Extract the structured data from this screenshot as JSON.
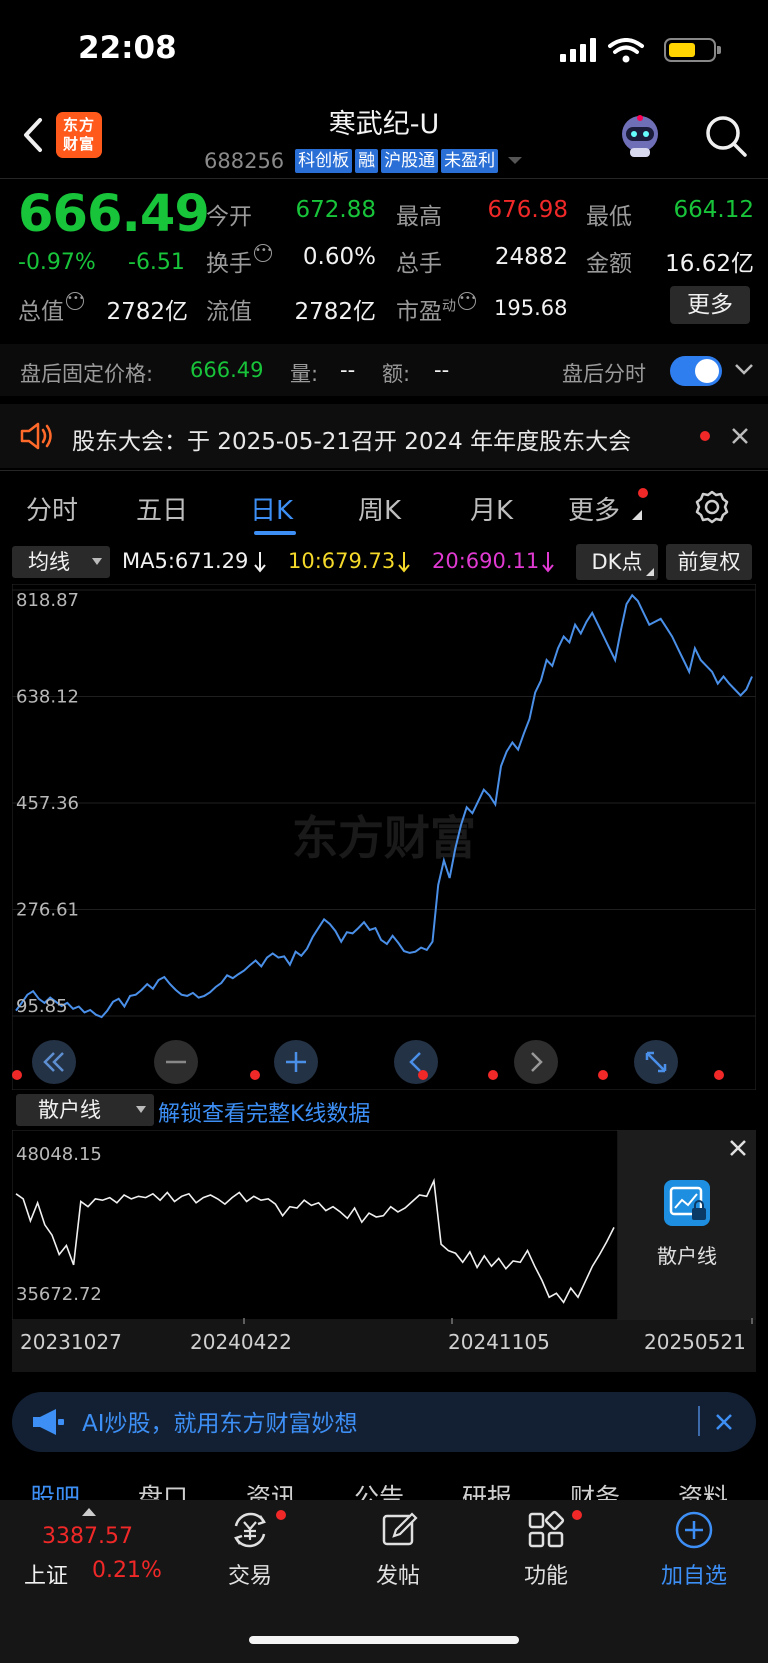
{
  "status_bar": {
    "time": "22:08"
  },
  "header": {
    "logo": "东方财富",
    "name": "寒武纪-U",
    "code": "688256",
    "tags": [
      "科创板",
      "融",
      "沪股通",
      "未盈利"
    ]
  },
  "quote": {
    "price": "666.49",
    "change_pct": "-0.97%",
    "change": "-6.51",
    "open_label": "今开",
    "open": "672.88",
    "high_label": "最高",
    "high": "676.98",
    "low_label": "最低",
    "low": "664.12",
    "turnover_label": "换手",
    "turnover": "0.60%",
    "volume_label": "总手",
    "volume": "24882",
    "amount_label": "金额",
    "amount": "16.62亿",
    "mktcap_label": "总值",
    "mktcap": "2782亿",
    "float_label": "流值",
    "float": "2782亿",
    "pe_label": "市盈",
    "pe_sup": "动",
    "pe": "195.68",
    "more": "更多"
  },
  "after_hours": {
    "label": "盘后固定价格:",
    "price": "666.49",
    "vol_label": "量:",
    "vol": "--",
    "amt_label": "额:",
    "amt": "--",
    "intraday_label": "盘后分时"
  },
  "notice": {
    "text": "股东大会：于 2025-05-21召开 2024 年年度股东大会"
  },
  "tabs": [
    "分时",
    "五日",
    "日K",
    "周K",
    "月K",
    "更多"
  ],
  "chart_header": {
    "ma_select": "均线",
    "ma5": "MA5:671.29",
    "ma10": "10:679.73",
    "ma20": "20:690.11",
    "dk": "DK点",
    "adjust": "前复权"
  },
  "watermark": "东方财富",
  "sub_indicator": {
    "select": "散户线",
    "unlock": "解锁查看完整K线数据",
    "panel_label": "散户线"
  },
  "ai_banner": {
    "text": "AI炒股，就用东方财富妙想"
  },
  "sub_tabs": [
    "股吧",
    "盘口",
    "资讯",
    "公告",
    "研报",
    "财务",
    "资料"
  ],
  "bottom_nav": {
    "index_value": "3387.57",
    "index_name": "上证",
    "index_pct": "0.21%",
    "items": [
      "交易",
      "发帖",
      "功能",
      "加自选"
    ]
  },
  "colors": {
    "up": "#f02828",
    "down": "#18c43a",
    "accent": "#3d8ff5",
    "price_line": "#4a8fe8"
  },
  "chart_data": [
    {
      "type": "line",
      "y_ticks": [
        "818.87",
        "638.12",
        "457.36",
        "276.61",
        "95.85"
      ],
      "ylim": [
        95.85,
        818.87
      ],
      "series": [
        {
          "values": [
            105,
            118,
            132,
            138,
            125,
            118,
            127,
            120,
            113,
            118,
            108,
            112,
            102,
            106,
            98,
            94,
            105,
            120,
            125,
            112,
            130,
            132,
            140,
            150,
            142,
            157,
            162,
            150,
            140,
            132,
            130,
            135,
            127,
            130,
            136,
            145,
            152,
            165,
            160,
            167,
            173,
            182,
            190,
            180,
            195,
            202,
            195,
            197,
            183,
            205,
            198,
            210,
            230,
            245,
            260,
            252,
            240,
            222,
            238,
            236,
            245,
            255,
            242,
            245,
            225,
            218,
            232,
            220,
            206,
            203,
            205,
            212,
            208,
            222,
            318,
            360,
            330,
            380,
            420,
            450,
            440,
            460,
            480,
            470,
            455,
            520,
            545,
            560,
            548,
            575,
            600,
            645,
            665,
            700,
            690,
            720,
            740,
            730,
            760,
            745,
            765,
            780,
            760,
            740,
            720,
            700,
            750,
            795,
            810,
            800,
            780,
            760,
            765,
            770,
            755,
            740,
            720,
            700,
            680,
            720,
            700,
            690,
            680,
            660,
            672,
            660,
            650,
            640,
            650,
            672
          ]
        }
      ]
    },
    {
      "type": "line",
      "y_ticks": [
        "48048.15",
        "35672.72"
      ],
      "ylim": [
        35672.72,
        48048.15
      ],
      "x_ticks": [
        "20231027",
        "20240422",
        "20241105",
        "20250521"
      ],
      "series": [
        {
          "values": [
            44200,
            43800,
            42100,
            43500,
            41800,
            41000,
            39500,
            40200,
            38700,
            43600,
            43200,
            43800,
            43700,
            43900,
            43500,
            44100,
            43800,
            44000,
            43900,
            44200,
            43700,
            44300,
            43600,
            44000,
            44200,
            43500,
            43900,
            44100,
            43800,
            43400,
            43900,
            44300,
            43600,
            44000,
            43700,
            43800,
            43400,
            42500,
            43200,
            43100,
            43700,
            43300,
            43500,
            42900,
            43200,
            42800,
            42300,
            43100,
            42000,
            42700,
            42400,
            42500,
            43200,
            42800,
            43100,
            43600,
            44100,
            44000,
            45200,
            40300,
            39800,
            39600,
            38900,
            39700,
            38500,
            39400,
            38600,
            39200,
            38400,
            39000,
            38900,
            39800,
            38600,
            37500,
            36200,
            36500,
            35800,
            36900,
            36200,
            37400,
            38600,
            39500,
            40500,
            41600
          ]
        }
      ]
    }
  ]
}
